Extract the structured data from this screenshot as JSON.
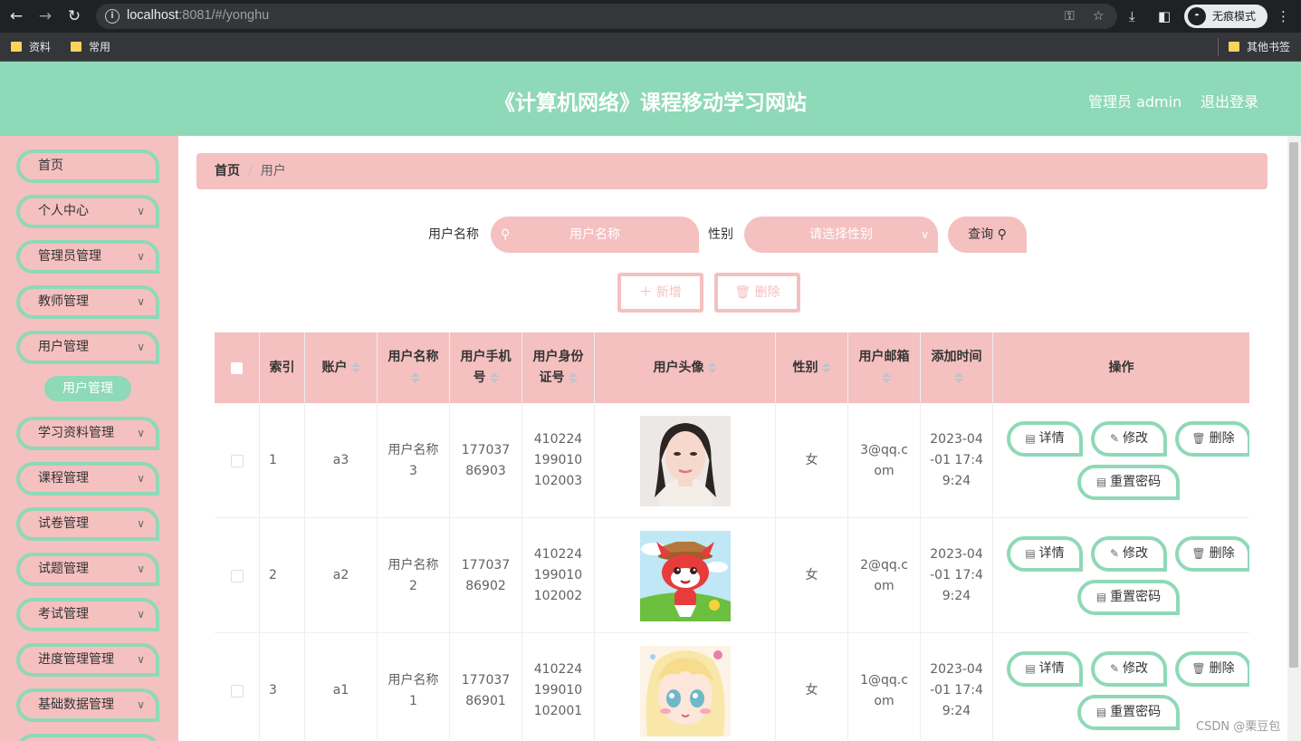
{
  "browser": {
    "url_host": "localhost",
    "url_rest": ":8081/#/yonghu",
    "incognito_label": "无痕模式",
    "bookmarks": [
      "资料",
      "常用"
    ],
    "other_bookmarks": "其他书签"
  },
  "header": {
    "title": "《计算机网络》课程移动学习网站",
    "user": "管理员 admin",
    "logout": "退出登录"
  },
  "sidebar": {
    "items": [
      {
        "label": "首页"
      },
      {
        "label": "个人中心"
      },
      {
        "label": "管理员管理"
      },
      {
        "label": "教师管理"
      },
      {
        "label": "用户管理"
      },
      {
        "label": "学习资料管理"
      },
      {
        "label": "课程管理"
      },
      {
        "label": "试卷管理"
      },
      {
        "label": "试题管理"
      },
      {
        "label": "考试管理"
      },
      {
        "label": "进度管理管理"
      },
      {
        "label": "基础数据管理"
      }
    ],
    "active_sub": "用户管理"
  },
  "breadcrumb": {
    "home": "首页",
    "sep": "/",
    "current": "用户"
  },
  "search": {
    "name_label": "用户名称",
    "name_placeholder": "用户名称",
    "gender_label": "性别",
    "gender_placeholder": "请选择性别",
    "query_label": "查询"
  },
  "actions": {
    "add": "新增",
    "delete": "删除"
  },
  "table": {
    "headers": [
      "索引",
      "账户",
      "用户名称",
      "用户手机号",
      "用户身份证号",
      "用户头像",
      "性别",
      "用户邮箱",
      "添加时间",
      "操作"
    ],
    "rows": [
      {
        "index": "1",
        "account": "a3",
        "name": "用户名称3",
        "phone": "17703786903",
        "id_card": "410224199010102003",
        "avatar": "portrait-woman",
        "gender": "女",
        "email": "3@qq.com",
        "time": "2023-04-01 17:49:24"
      },
      {
        "index": "2",
        "account": "a2",
        "name": "用户名称2",
        "phone": "17703786902",
        "id_card": "410224199010102002",
        "avatar": "cartoon-fox",
        "gender": "女",
        "email": "2@qq.com",
        "time": "2023-04-01 17:49:24"
      },
      {
        "index": "3",
        "account": "a1",
        "name": "用户名称1",
        "phone": "17703786901",
        "id_card": "410224199010102001",
        "avatar": "anime-girl",
        "gender": "女",
        "email": "1@qq.com",
        "time": "2023-04-01 17:49:24"
      }
    ],
    "row_actions": {
      "detail": "详情",
      "edit": "修改",
      "delete": "删除",
      "reset": "重置密码"
    }
  },
  "watermark": "CSDN @栗豆包",
  "colors": {
    "header": "#8ed9b7",
    "sidebar": "#f5c0c0",
    "accent": "#8ed9b7"
  }
}
